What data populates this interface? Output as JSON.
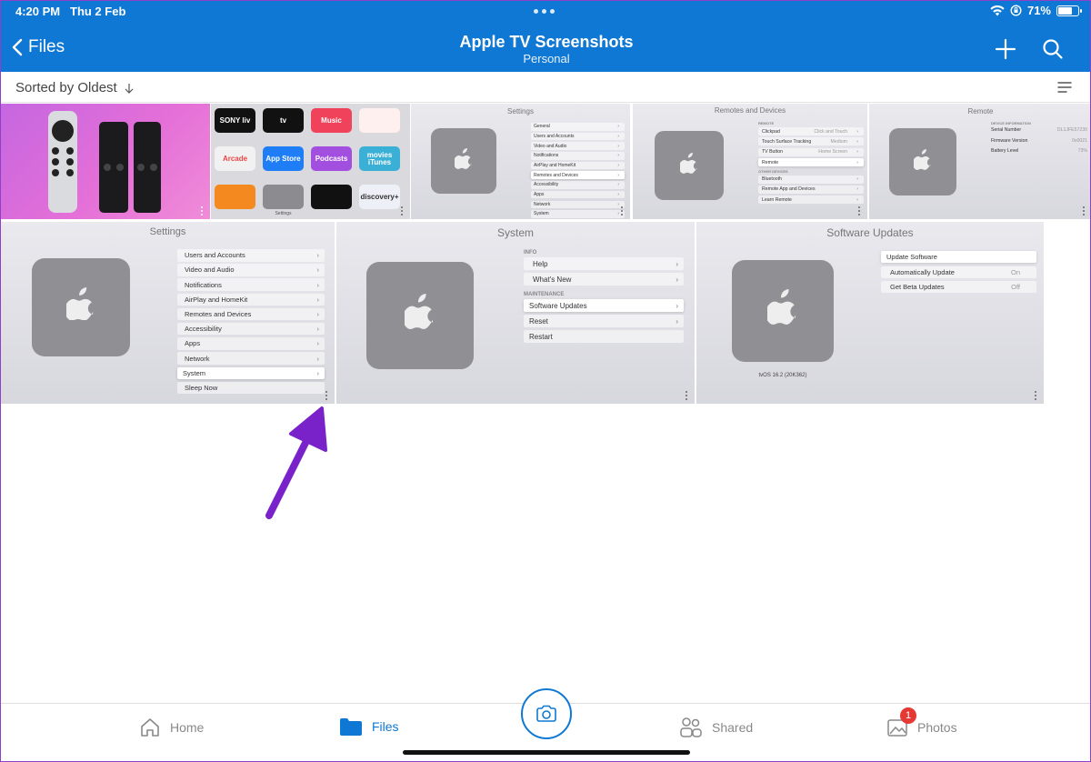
{
  "status": {
    "time": "4:20 PM",
    "date": "Thu 2 Feb",
    "battery": "71%",
    "battery_level": 0.71
  },
  "header": {
    "back_label": "Files",
    "title": "Apple TV Screenshots",
    "subtitle": "Personal"
  },
  "toolbar": {
    "sort_label": "Sorted by Oldest"
  },
  "row1": {
    "apps": [
      "SONY liv",
      "tv",
      "Music",
      "",
      "Arcade",
      "App Store",
      "Podcasts",
      "movies iTunes",
      "",
      "Settings",
      "",
      "discovery+"
    ],
    "settings": {
      "title": "Settings",
      "items": [
        "General",
        "Users and Accounts",
        "Video and Audio",
        "Notifications",
        "AirPlay and HomeKit",
        "Remotes and Devices",
        "Accessibility",
        "Apps",
        "Network",
        "System"
      ],
      "selected": 5
    },
    "remotes": {
      "title": "Remotes and Devices",
      "section1": "REMOTE",
      "items1": [
        {
          "label": "Clickpad",
          "value": "Click and Touch"
        },
        {
          "label": "Touch Surface Tracking",
          "value": "Medium"
        },
        {
          "label": "TV Button",
          "value": "Home Screen"
        },
        {
          "label": "Remote",
          "value": ""
        }
      ],
      "section2": "OTHER DEVICES",
      "items2": [
        "Bluetooth",
        "Remote App and Devices",
        "Learn Remote"
      ]
    },
    "remote": {
      "title": "Remote",
      "section": "DEVICE INFORMATION",
      "rows": [
        {
          "label": "Serial Number",
          "value": "DL1JFE57230"
        },
        {
          "label": "Firmware Version",
          "value": "0x0021"
        },
        {
          "label": "Battery Level",
          "value": "73%"
        }
      ]
    }
  },
  "row2": {
    "settings": {
      "title": "Settings",
      "items": [
        "Users and Accounts",
        "Video and Audio",
        "Notifications",
        "AirPlay and HomeKit",
        "Remotes and Devices",
        "Accessibility",
        "Apps",
        "Network",
        "System",
        "Sleep Now"
      ],
      "selected": 8
    },
    "system": {
      "title": "System",
      "section1": "INFO",
      "items1": [
        "Help",
        "What's New"
      ],
      "section2": "MAINTENANCE",
      "items2": [
        "Software Updates",
        "Reset",
        "Restart"
      ]
    },
    "updates": {
      "title": "Software Updates",
      "items": [
        {
          "label": "Update Software",
          "value": ""
        },
        {
          "label": "Automatically Update",
          "value": "On"
        },
        {
          "label": "Get Beta Updates",
          "value": "Off"
        }
      ],
      "version": "tvOS 16.2 (20K362)"
    }
  },
  "tabs": {
    "home": "Home",
    "files": "Files",
    "shared": "Shared",
    "photos": "Photos",
    "photos_badge": "1"
  },
  "colors": {
    "accent": "#0f78d4",
    "annotation_arrow": "#7a22c9",
    "badge": "#e53935"
  }
}
